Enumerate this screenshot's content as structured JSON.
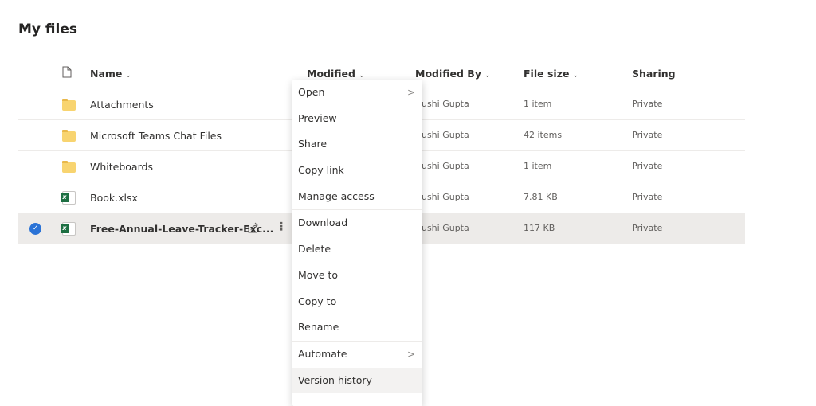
{
  "title": "My files",
  "columns": {
    "name": "Name",
    "modified": "Modified",
    "modified_by": "Modified By",
    "file_size": "File size",
    "sharing": "Sharing"
  },
  "rows": [
    {
      "name": "Attachments",
      "type": "folder",
      "modified_by": "nushi Gupta",
      "size": "1 item",
      "sharing": "Private"
    },
    {
      "name": "Microsoft Teams Chat Files",
      "type": "folder",
      "modified_by": "nushi Gupta",
      "size": "42 items",
      "sharing": "Private"
    },
    {
      "name": "Whiteboards",
      "type": "folder",
      "modified_by": "nushi Gupta",
      "size": "1 item",
      "sharing": "Private"
    },
    {
      "name": "Book.xlsx",
      "type": "excel",
      "modified_by": "nushi Gupta",
      "size": "7.81 KB",
      "sharing": "Private"
    },
    {
      "name": "Free-Annual-Leave-Tracker-Exc...",
      "type": "excel",
      "modified_by": "nushi Gupta",
      "size": "117 KB",
      "sharing": "Private",
      "selected": true
    }
  ],
  "menu": {
    "items": [
      "Open",
      "Preview",
      "Share",
      "Copy link",
      "Manage access",
      "Download",
      "Delete",
      "Move to",
      "Copy to",
      "Rename",
      "Automate",
      "Version history"
    ]
  },
  "colors": {
    "accent": "#2b73d6",
    "selected_row": "#edebe9"
  }
}
